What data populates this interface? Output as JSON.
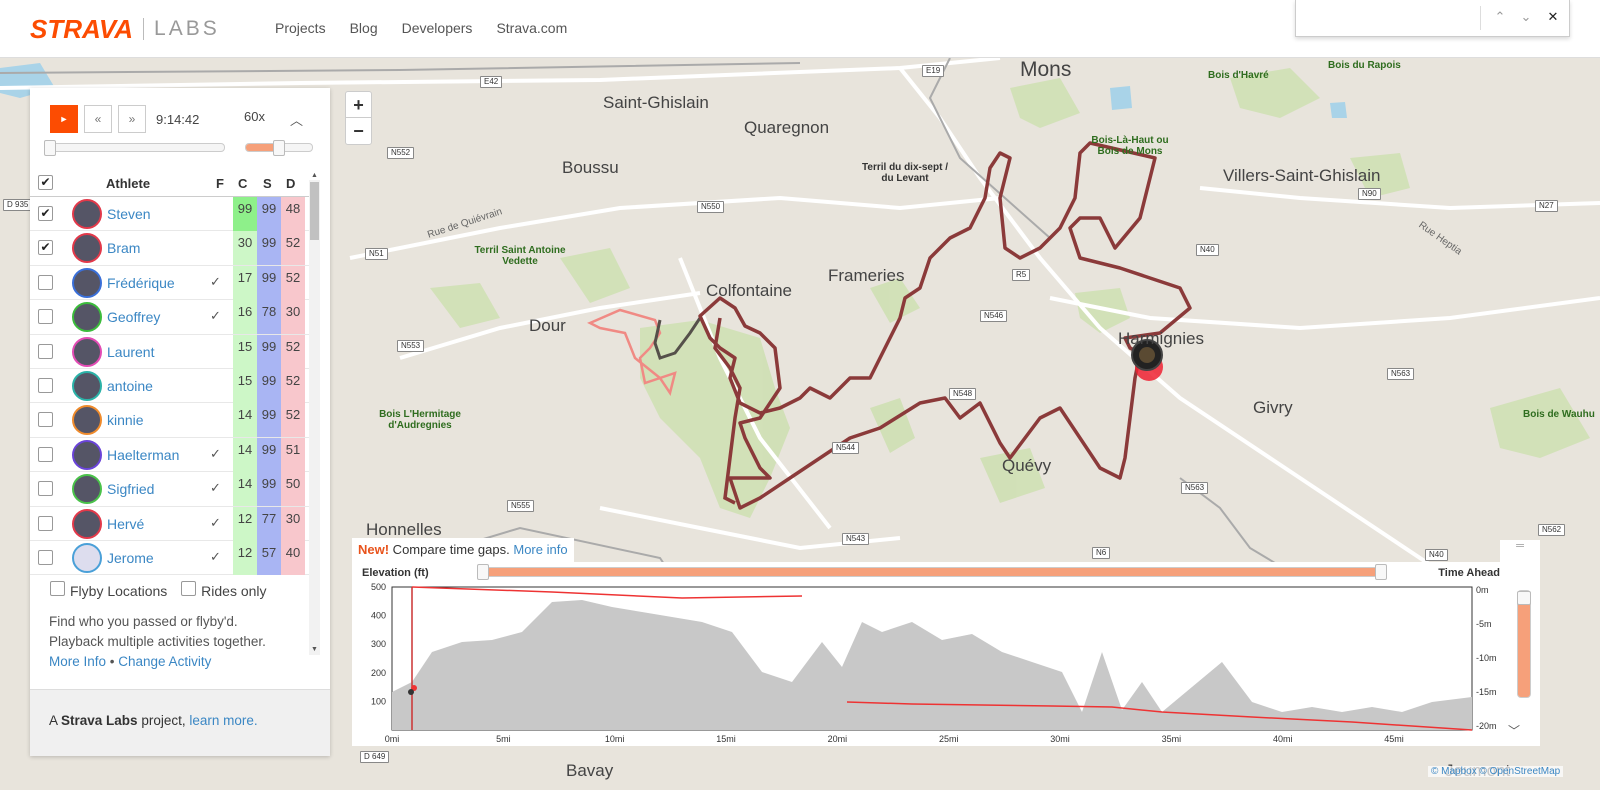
{
  "header": {
    "logo_brand": "STRAVA",
    "logo_labs": "LABS",
    "nav": [
      "Projects",
      "Blog",
      "Developers",
      "Strava.com"
    ]
  },
  "findbar": {
    "value": "",
    "prev": "⌃",
    "next": "⌄",
    "close": "✕"
  },
  "map": {
    "zoom_in": "+",
    "zoom_out": "−",
    "places": [
      {
        "name": "Mons"
      },
      {
        "name": "Saint-Ghislain"
      },
      {
        "name": "Quaregnon"
      },
      {
        "name": "Boussu"
      },
      {
        "name": "Frameries"
      },
      {
        "name": "Colfontaine"
      },
      {
        "name": "Dour"
      },
      {
        "name": "Villers-Saint-Ghislain"
      },
      {
        "name": "Harmignies"
      },
      {
        "name": "Givry"
      },
      {
        "name": "Quévy"
      },
      {
        "name": "Honnelles"
      },
      {
        "name": "Bavay"
      },
      {
        "name": "Jeumont"
      }
    ],
    "woods": [
      "Bois d'Havré",
      "Bois du Rapois",
      "Bois-Là-Haut ou Bois de Mons",
      "Terril du dix-sept / du Levant",
      "Terril Saint Antoine Vedette",
      "Bois L'Hermitage d'Audregnies",
      "Bois de Wauhu"
    ],
    "roads": [
      "E42",
      "E19",
      "N552",
      "N550",
      "N51",
      "N553",
      "R5",
      "N546",
      "N548",
      "N544",
      "N555",
      "N543",
      "N6",
      "N563",
      "N40",
      "N90",
      "N27",
      "N562",
      "D 935",
      "D 649",
      "N40",
      "N563"
    ],
    "streets": [
      "Rue de Quiévrain",
      "Rue Heptia"
    ],
    "attribution": "© Mapbox © OpenStreetMap"
  },
  "player": {
    "play": "►",
    "rewind": "«",
    "forward": "»",
    "time": "9:14:42",
    "speed": "60x",
    "progress": 0.0,
    "speed_level": 0.5
  },
  "table": {
    "columns": {
      "athlete": "Athlete",
      "f": "F",
      "c": "C",
      "s": "S",
      "d": "D"
    },
    "rows": [
      {
        "name": "Steven",
        "checked": true,
        "flyby": "",
        "c": "99",
        "s": "99",
        "d": "48",
        "ring": "red"
      },
      {
        "name": "Bram",
        "checked": true,
        "flyby": "",
        "c": "30",
        "s": "99",
        "d": "52",
        "ring": "red"
      },
      {
        "name": "Frédérique",
        "checked": false,
        "flyby": "✓",
        "c": "17",
        "s": "99",
        "d": "52",
        "ring": "blue"
      },
      {
        "name": "Geoffrey",
        "checked": false,
        "flyby": "✓",
        "c": "16",
        "s": "78",
        "d": "30",
        "ring": "green"
      },
      {
        "name": "Laurent",
        "checked": false,
        "flyby": "",
        "c": "15",
        "s": "99",
        "d": "52",
        "ring": "pink"
      },
      {
        "name": "antoine",
        "checked": false,
        "flyby": "",
        "c": "15",
        "s": "99",
        "d": "52",
        "ring": "teal"
      },
      {
        "name": "kinnie",
        "checked": false,
        "flyby": "",
        "c": "14",
        "s": "99",
        "d": "52",
        "ring": "orange"
      },
      {
        "name": "Haelterman",
        "checked": false,
        "flyby": "✓",
        "c": "14",
        "s": "99",
        "d": "51",
        "ring": "purple"
      },
      {
        "name": "Sigfried",
        "checked": false,
        "flyby": "✓",
        "c": "14",
        "s": "99",
        "d": "50",
        "ring": "lgreen"
      },
      {
        "name": "Hervé",
        "checked": false,
        "flyby": "✓",
        "c": "12",
        "s": "77",
        "d": "30",
        "ring": "red"
      },
      {
        "name": "Jerome",
        "checked": false,
        "flyby": "✓",
        "c": "12",
        "s": "57",
        "d": "40",
        "ring": "lblue"
      }
    ]
  },
  "options": {
    "flyby_locations": "Flyby Locations",
    "rides_only": "Rides only"
  },
  "desc": {
    "line1": "Find who you passed or flyby'd.",
    "line2": "Playback multiple activities together.",
    "more_info": "More Info",
    "sep": " • ",
    "change": "Change Activity"
  },
  "footer": {
    "prefix": "A ",
    "brand": "Strava Labs",
    "mid": " project, ",
    "link": "learn more."
  },
  "elevation": {
    "new_label": "New!",
    "new_text": " Compare time gaps.",
    "new_link": "More info",
    "title": "Elevation (ft)",
    "right_title": "Time Ahead",
    "yticks": [
      "500",
      "400",
      "300",
      "200",
      "100"
    ],
    "xticks": [
      "0mi",
      "5mi",
      "10mi",
      "15mi",
      "20mi",
      "25mi",
      "30mi",
      "35mi",
      "40mi",
      "45mi"
    ],
    "right_ticks": [
      "0m",
      "-5m",
      "-10m",
      "-15m",
      "-20m"
    ]
  },
  "colors": {
    "brand": "#fc4c02",
    "route": "#8b3a3a",
    "link": "#3b87c4"
  }
}
